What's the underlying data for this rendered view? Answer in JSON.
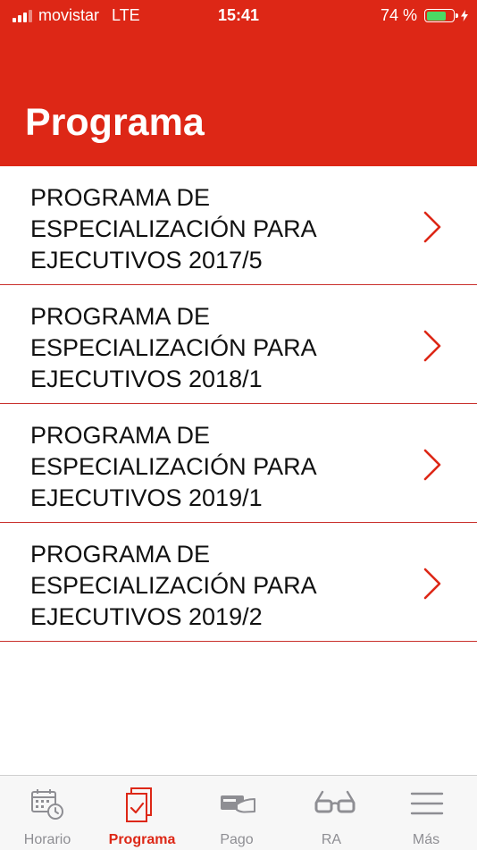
{
  "status_bar": {
    "carrier": "movistar",
    "network": "LTE",
    "time": "15:41",
    "battery_percent": "74 %",
    "battery_level": 0.74
  },
  "header": {
    "title": "Programa",
    "background_color": "#dd2716"
  },
  "programs": [
    {
      "line1": "PROGRAMA DE",
      "line2": "ESPECIALIZACIÓN PARA",
      "line3": "EJECUTIVOS 2017/5"
    },
    {
      "line1": "PROGRAMA DE",
      "line2": "ESPECIALIZACIÓN PARA",
      "line3": "EJECUTIVOS 2018/1"
    },
    {
      "line1": "PROGRAMA DE",
      "line2": "ESPECIALIZACIÓN PARA",
      "line3": "EJECUTIVOS 2019/1"
    },
    {
      "line1": "PROGRAMA DE",
      "line2": "ESPECIALIZACIÓN PARA",
      "line3": "EJECUTIVOS 2019/2"
    }
  ],
  "tabbar": {
    "active": "Programa",
    "items": [
      {
        "label": "Horario",
        "icon": "calendar-clock-icon"
      },
      {
        "label": "Programa",
        "icon": "document-check-icon"
      },
      {
        "label": "Pago",
        "icon": "hand-card-icon"
      },
      {
        "label": "RA",
        "icon": "ar-glasses-icon"
      },
      {
        "label": "Más",
        "icon": "menu-icon"
      }
    ]
  }
}
